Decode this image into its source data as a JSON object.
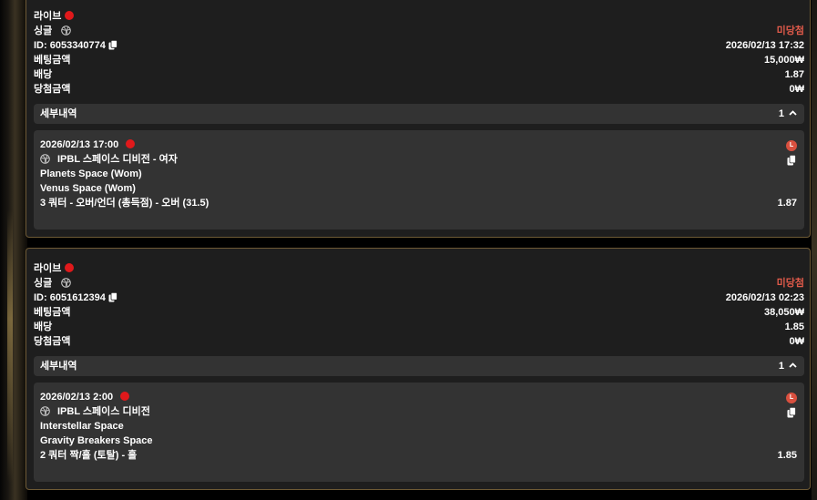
{
  "labels": {
    "bet_amount": "베팅금액",
    "odds": "배당",
    "win_amount": "당첨금액",
    "details": "세부내역"
  },
  "icons": {
    "live_dot": "red-dot",
    "sport": "basketball-icon",
    "copy": "copy-icon",
    "expand": "chevron-up-icon",
    "league_badge": "L"
  },
  "colors": {
    "status_pending": "#e05a4a",
    "live_dot": "#e0191b",
    "card_border": "#6e5a35"
  },
  "bets": [
    {
      "live_label": "라이브",
      "type_label": "싱글",
      "status": "미당첨",
      "id_text": "ID: 6053340774",
      "datetime": "2026/02/13 17:32",
      "bet_amount": "15,000₩",
      "odds": "1.87",
      "win_amount": "0₩",
      "detail_count": "1",
      "selection": {
        "match_time": "2026/02/13 17:00",
        "badge": "L",
        "league": "IPBL 스페이스 디비전 - 여자",
        "home": "Planets Space (Wom)",
        "away": "Venus Space (Wom)",
        "market": "3 쿼터 - 오버/언더 (총득점) - 오버 (31.5)",
        "odds": "1.87"
      }
    },
    {
      "live_label": "라이브",
      "type_label": "싱글",
      "status": "미당첨",
      "id_text": "ID: 6051612394",
      "datetime": "2026/02/13 02:23",
      "bet_amount": "38,050₩",
      "odds": "1.85",
      "win_amount": "0₩",
      "detail_count": "1",
      "selection": {
        "match_time": "2026/02/13 2:00",
        "badge": "L",
        "league": "IPBL 스페이스 디비전",
        "home": "Interstellar Space",
        "away": "Gravity Breakers Space",
        "market": "2 쿼터 짝/홀 (토탈) - 홀",
        "odds": "1.85"
      }
    }
  ]
}
